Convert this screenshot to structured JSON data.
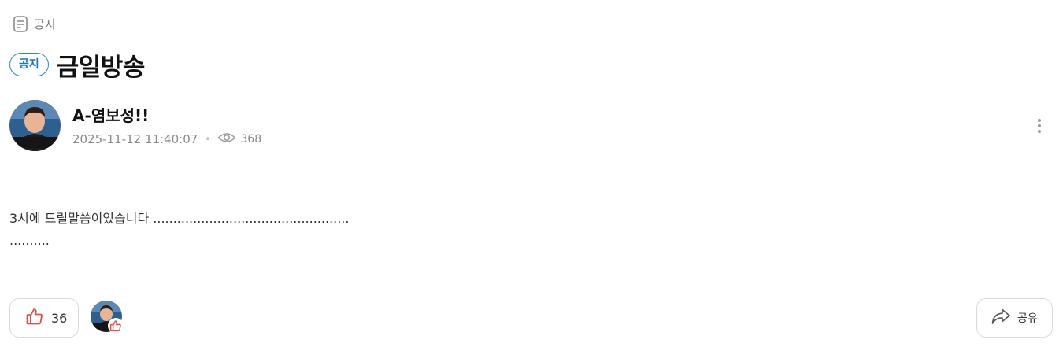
{
  "breadcrumb": {
    "icon": "document-icon",
    "label": "공지"
  },
  "post": {
    "badge": "공지",
    "title": "금일방송",
    "author": {
      "name": "A-염보성!!",
      "avatar_caption": "염보성"
    },
    "datetime": "2025-11-12 11:40:07",
    "views": "368",
    "body_line1": "3시에 드릴말씀이있습니다 .................................................",
    "body_line2": ".........."
  },
  "actions": {
    "like_count": "36",
    "share_label": "공유"
  },
  "colors": {
    "accent_blue": "#1f77b9",
    "like_red": "#e0504a",
    "text_muted": "#8a8a8a",
    "divider": "#e3e3e3"
  }
}
